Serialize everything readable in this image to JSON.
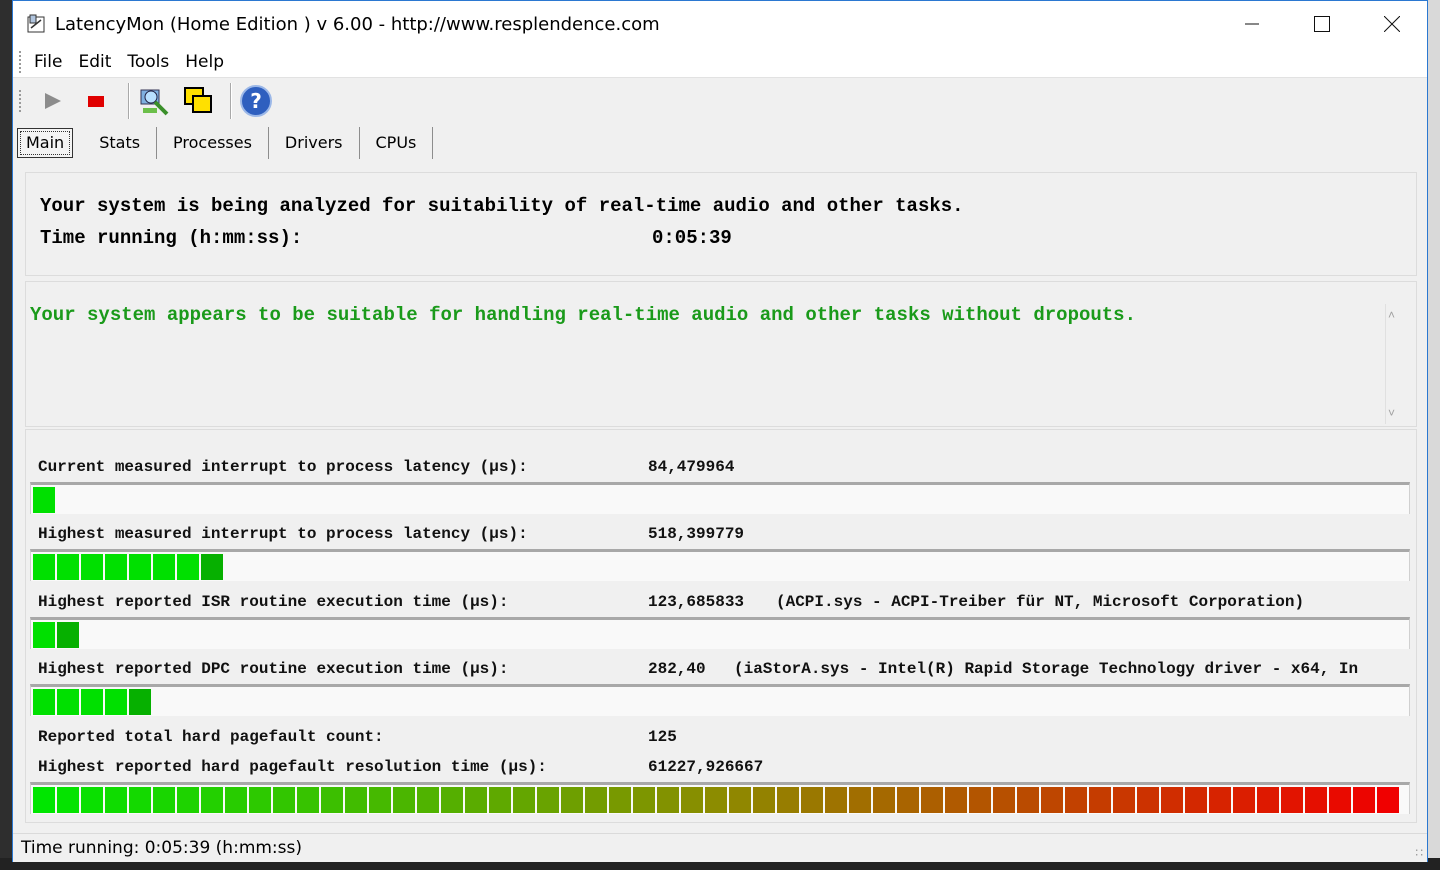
{
  "window": {
    "title": "LatencyMon  (Home Edition )  v 6.00 - http://www.resplendence.com"
  },
  "menu": [
    "File",
    "Edit",
    "Tools",
    "Help"
  ],
  "toolbar": {
    "buttons": [
      "play-icon",
      "stop-icon",
      "analyze-icon",
      "windows-icon",
      "help-icon"
    ]
  },
  "tabs": [
    "Main",
    "Stats",
    "Processes",
    "Drivers",
    "CPUs"
  ],
  "main": {
    "analyzing_text": "Your system is being analyzed for suitability of real-time audio and other tasks.",
    "time_label": "Time running (h:mm:ss):",
    "time_value": "0:05:39",
    "verdict": "Your system appears to be suitable for handling real-time audio and other tasks without dropouts."
  },
  "metrics": [
    {
      "label": "Current measured interrupt to process latency (µs):",
      "value": "84,479964",
      "extra": "",
      "level": 0.014
    },
    {
      "label": "Highest measured interrupt to process latency (µs):",
      "value": "518,399779",
      "extra": "",
      "level": 0.136
    },
    {
      "label": "Highest reported ISR routine execution time (µs):",
      "value": "123,685833",
      "extra": "(ACPI.sys - ACPI-Treiber für NT, Microsoft Corporation)",
      "level": 0.032
    },
    {
      "label": "Highest reported DPC routine execution time (µs):",
      "value": "282,40",
      "extra": "(iaStorA.sys - Intel(R) Rapid Storage Technology driver - x64, In",
      "level": 0.084
    },
    {
      "label": "Reported total hard pagefault count:",
      "value": "125",
      "extra": "",
      "level": null
    },
    {
      "label": "Highest reported hard pagefault resolution time (µs):",
      "value": "61227,926667",
      "extra": "",
      "level": 1.0
    }
  ],
  "status": {
    "text": "Time running: 0:05:39  (h:mm:ss)"
  },
  "colors": {
    "verdict_text": "#1a9a1a",
    "bar_green": "#00e000",
    "bar_red": "#f00000"
  }
}
